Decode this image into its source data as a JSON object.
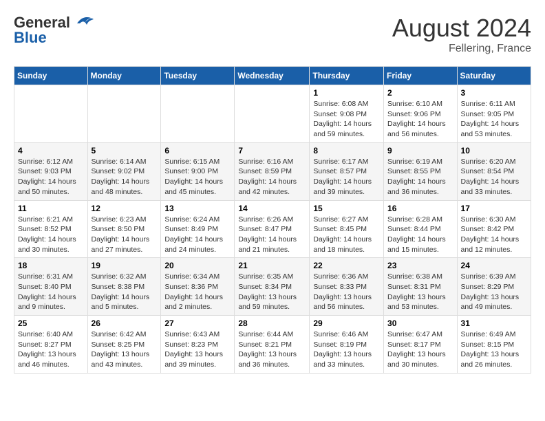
{
  "header": {
    "logo_general": "General",
    "logo_blue": "Blue",
    "month_year": "August 2024",
    "location": "Fellering, France"
  },
  "weekdays": [
    "Sunday",
    "Monday",
    "Tuesday",
    "Wednesday",
    "Thursday",
    "Friday",
    "Saturday"
  ],
  "weeks": [
    [
      {
        "day": "",
        "info": ""
      },
      {
        "day": "",
        "info": ""
      },
      {
        "day": "",
        "info": ""
      },
      {
        "day": "",
        "info": ""
      },
      {
        "day": "1",
        "info": "Sunrise: 6:08 AM\nSunset: 9:08 PM\nDaylight: 14 hours and 59 minutes."
      },
      {
        "day": "2",
        "info": "Sunrise: 6:10 AM\nSunset: 9:06 PM\nDaylight: 14 hours and 56 minutes."
      },
      {
        "day": "3",
        "info": "Sunrise: 6:11 AM\nSunset: 9:05 PM\nDaylight: 14 hours and 53 minutes."
      }
    ],
    [
      {
        "day": "4",
        "info": "Sunrise: 6:12 AM\nSunset: 9:03 PM\nDaylight: 14 hours and 50 minutes."
      },
      {
        "day": "5",
        "info": "Sunrise: 6:14 AM\nSunset: 9:02 PM\nDaylight: 14 hours and 48 minutes."
      },
      {
        "day": "6",
        "info": "Sunrise: 6:15 AM\nSunset: 9:00 PM\nDaylight: 14 hours and 45 minutes."
      },
      {
        "day": "7",
        "info": "Sunrise: 6:16 AM\nSunset: 8:59 PM\nDaylight: 14 hours and 42 minutes."
      },
      {
        "day": "8",
        "info": "Sunrise: 6:17 AM\nSunset: 8:57 PM\nDaylight: 14 hours and 39 minutes."
      },
      {
        "day": "9",
        "info": "Sunrise: 6:19 AM\nSunset: 8:55 PM\nDaylight: 14 hours and 36 minutes."
      },
      {
        "day": "10",
        "info": "Sunrise: 6:20 AM\nSunset: 8:54 PM\nDaylight: 14 hours and 33 minutes."
      }
    ],
    [
      {
        "day": "11",
        "info": "Sunrise: 6:21 AM\nSunset: 8:52 PM\nDaylight: 14 hours and 30 minutes."
      },
      {
        "day": "12",
        "info": "Sunrise: 6:23 AM\nSunset: 8:50 PM\nDaylight: 14 hours and 27 minutes."
      },
      {
        "day": "13",
        "info": "Sunrise: 6:24 AM\nSunset: 8:49 PM\nDaylight: 14 hours and 24 minutes."
      },
      {
        "day": "14",
        "info": "Sunrise: 6:26 AM\nSunset: 8:47 PM\nDaylight: 14 hours and 21 minutes."
      },
      {
        "day": "15",
        "info": "Sunrise: 6:27 AM\nSunset: 8:45 PM\nDaylight: 14 hours and 18 minutes."
      },
      {
        "day": "16",
        "info": "Sunrise: 6:28 AM\nSunset: 8:44 PM\nDaylight: 14 hours and 15 minutes."
      },
      {
        "day": "17",
        "info": "Sunrise: 6:30 AM\nSunset: 8:42 PM\nDaylight: 14 hours and 12 minutes."
      }
    ],
    [
      {
        "day": "18",
        "info": "Sunrise: 6:31 AM\nSunset: 8:40 PM\nDaylight: 14 hours and 9 minutes."
      },
      {
        "day": "19",
        "info": "Sunrise: 6:32 AM\nSunset: 8:38 PM\nDaylight: 14 hours and 5 minutes."
      },
      {
        "day": "20",
        "info": "Sunrise: 6:34 AM\nSunset: 8:36 PM\nDaylight: 14 hours and 2 minutes."
      },
      {
        "day": "21",
        "info": "Sunrise: 6:35 AM\nSunset: 8:34 PM\nDaylight: 13 hours and 59 minutes."
      },
      {
        "day": "22",
        "info": "Sunrise: 6:36 AM\nSunset: 8:33 PM\nDaylight: 13 hours and 56 minutes."
      },
      {
        "day": "23",
        "info": "Sunrise: 6:38 AM\nSunset: 8:31 PM\nDaylight: 13 hours and 53 minutes."
      },
      {
        "day": "24",
        "info": "Sunrise: 6:39 AM\nSunset: 8:29 PM\nDaylight: 13 hours and 49 minutes."
      }
    ],
    [
      {
        "day": "25",
        "info": "Sunrise: 6:40 AM\nSunset: 8:27 PM\nDaylight: 13 hours and 46 minutes."
      },
      {
        "day": "26",
        "info": "Sunrise: 6:42 AM\nSunset: 8:25 PM\nDaylight: 13 hours and 43 minutes."
      },
      {
        "day": "27",
        "info": "Sunrise: 6:43 AM\nSunset: 8:23 PM\nDaylight: 13 hours and 39 minutes."
      },
      {
        "day": "28",
        "info": "Sunrise: 6:44 AM\nSunset: 8:21 PM\nDaylight: 13 hours and 36 minutes."
      },
      {
        "day": "29",
        "info": "Sunrise: 6:46 AM\nSunset: 8:19 PM\nDaylight: 13 hours and 33 minutes."
      },
      {
        "day": "30",
        "info": "Sunrise: 6:47 AM\nSunset: 8:17 PM\nDaylight: 13 hours and 30 minutes."
      },
      {
        "day": "31",
        "info": "Sunrise: 6:49 AM\nSunset: 8:15 PM\nDaylight: 13 hours and 26 minutes."
      }
    ]
  ]
}
